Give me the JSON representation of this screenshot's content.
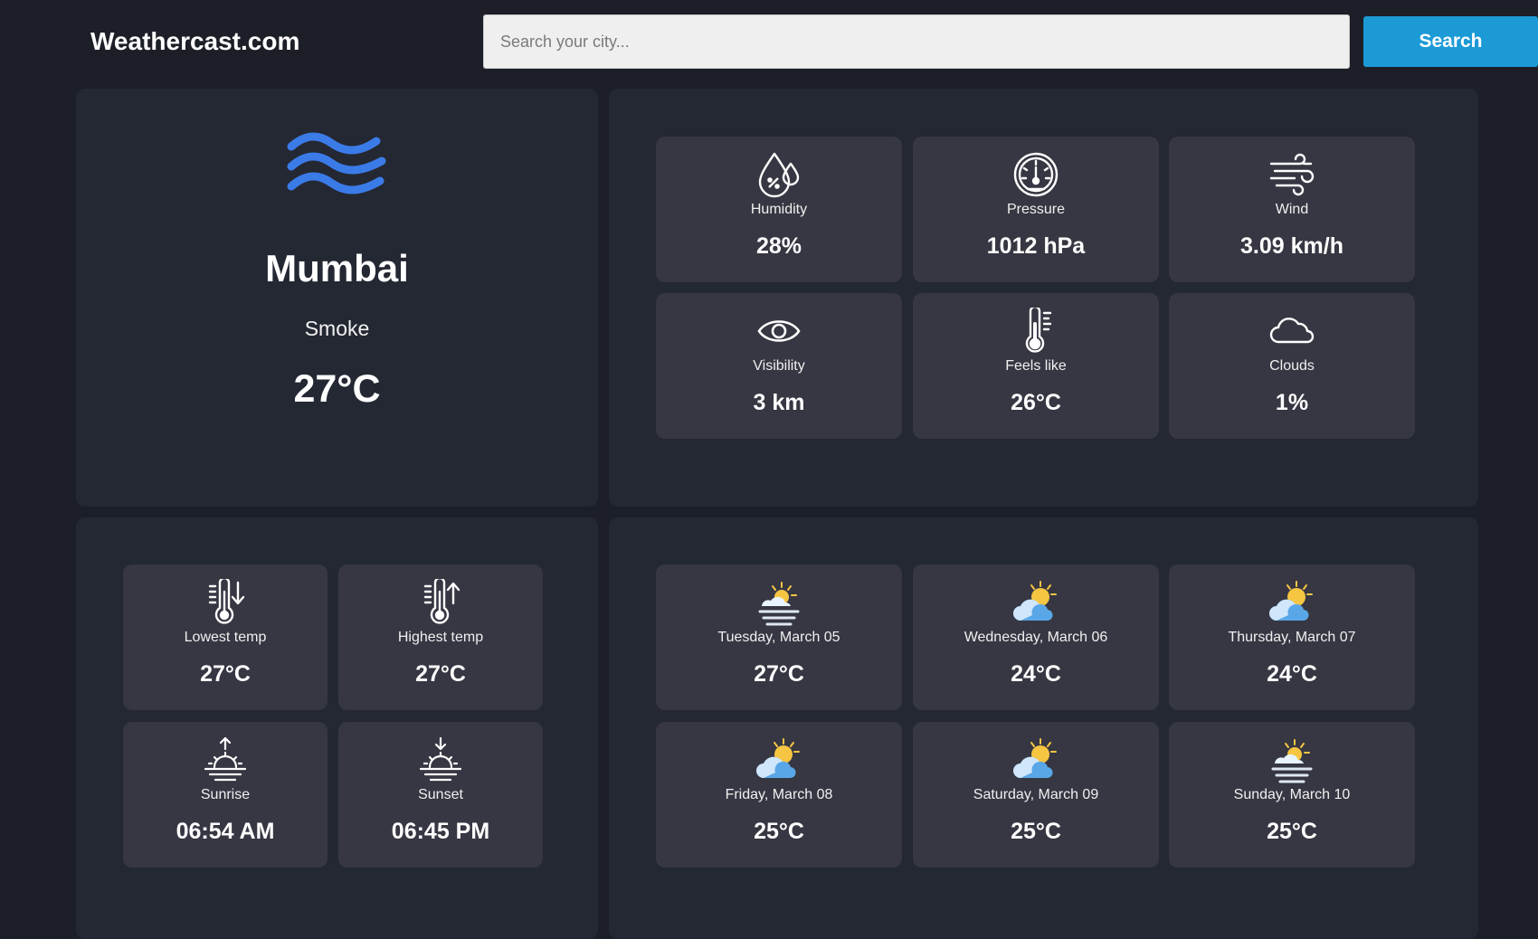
{
  "header": {
    "logo": "Weathercast.com",
    "search_placeholder": "Search your city...",
    "search_value": "",
    "search_button": "Search"
  },
  "current": {
    "icon": "wind-waves-icon",
    "city": "Mumbai",
    "condition": "Smoke",
    "temperature": "27°C"
  },
  "details": [
    {
      "icon": "humidity-icon",
      "label": "Humidity",
      "value": "28%"
    },
    {
      "icon": "pressure-gauge-icon",
      "label": "Pressure",
      "value": "1012 hPa"
    },
    {
      "icon": "wind-icon",
      "label": "Wind",
      "value": "3.09 km/h"
    },
    {
      "icon": "eye-icon",
      "label": "Visibility",
      "value": "3 km"
    },
    {
      "icon": "thermometer-icon",
      "label": "Feels like",
      "value": "26°C"
    },
    {
      "icon": "cloud-icon",
      "label": "Clouds",
      "value": "1%"
    }
  ],
  "extremes": [
    {
      "icon": "thermometer-down-icon",
      "label": "Lowest temp",
      "value": "27°C"
    },
    {
      "icon": "thermometer-up-icon",
      "label": "Highest temp",
      "value": "27°C"
    },
    {
      "icon": "sunrise-icon",
      "label": "Sunrise",
      "value": "06:54 AM"
    },
    {
      "icon": "sunset-icon",
      "label": "Sunset",
      "value": "06:45 PM"
    }
  ],
  "forecast": [
    {
      "icon": "sun-haze-icon",
      "label": "Tuesday, March 05",
      "value": "27°C"
    },
    {
      "icon": "partly-cloudy-icon",
      "label": "Wednesday, March 06",
      "value": "24°C"
    },
    {
      "icon": "partly-cloudy-icon",
      "label": "Thursday, March 07",
      "value": "24°C"
    },
    {
      "icon": "partly-cloudy-icon",
      "label": "Friday, March 08",
      "value": "25°C"
    },
    {
      "icon": "partly-cloudy-icon",
      "label": "Saturday, March 09",
      "value": "25°C"
    },
    {
      "icon": "sun-haze-icon",
      "label": "Sunday, March 10",
      "value": "25°C"
    }
  ],
  "colors": {
    "background": "#1c1f27",
    "panel": "#242833",
    "tile": "#363742",
    "accent": "#1b9ad6",
    "wave_icon": "#3b7be8"
  }
}
